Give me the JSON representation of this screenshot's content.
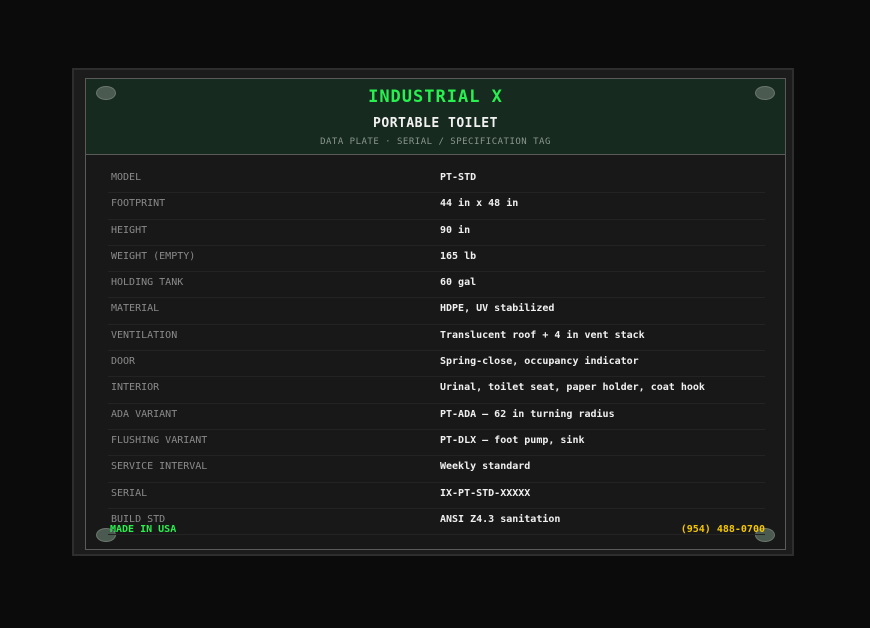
{
  "header": {
    "brand": "INDUSTRIAL X",
    "product": "PORTABLE TOILET",
    "subtitle": "DATA PLATE  ·  SERIAL / SPECIFICATION TAG"
  },
  "specs": [
    {
      "label": "MODEL",
      "value": "PT-STD"
    },
    {
      "label": "FOOTPRINT",
      "value": "44 in x 48 in"
    },
    {
      "label": "HEIGHT",
      "value": "90 in"
    },
    {
      "label": "WEIGHT (EMPTY)",
      "value": "165 lb"
    },
    {
      "label": "HOLDING TANK",
      "value": "60 gal"
    },
    {
      "label": "MATERIAL",
      "value": "HDPE, UV stabilized"
    },
    {
      "label": "VENTILATION",
      "value": "Translucent roof + 4 in vent stack"
    },
    {
      "label": "DOOR",
      "value": "Spring-close, occupancy indicator"
    },
    {
      "label": "INTERIOR",
      "value": "Urinal, toilet seat, paper holder, coat hook"
    },
    {
      "label": "ADA VARIANT",
      "value": "PT-ADA — 62 in turning radius"
    },
    {
      "label": "FLUSHING VARIANT",
      "value": "PT-DLX — foot pump, sink"
    },
    {
      "label": "SERVICE INTERVAL",
      "value": "Weekly standard"
    },
    {
      "label": "SERIAL",
      "value": "IX-PT-STD-XXXXX"
    },
    {
      "label": "BUILD STD",
      "value": "ANSI Z4.3 sanitation"
    }
  ],
  "footer": {
    "origin": "MADE IN USA",
    "phone": "(954) 488-0700"
  },
  "colors": {
    "brand_green": "#27f04f",
    "phone_yellow": "#f4c600",
    "header_bg": "#162a1f"
  }
}
